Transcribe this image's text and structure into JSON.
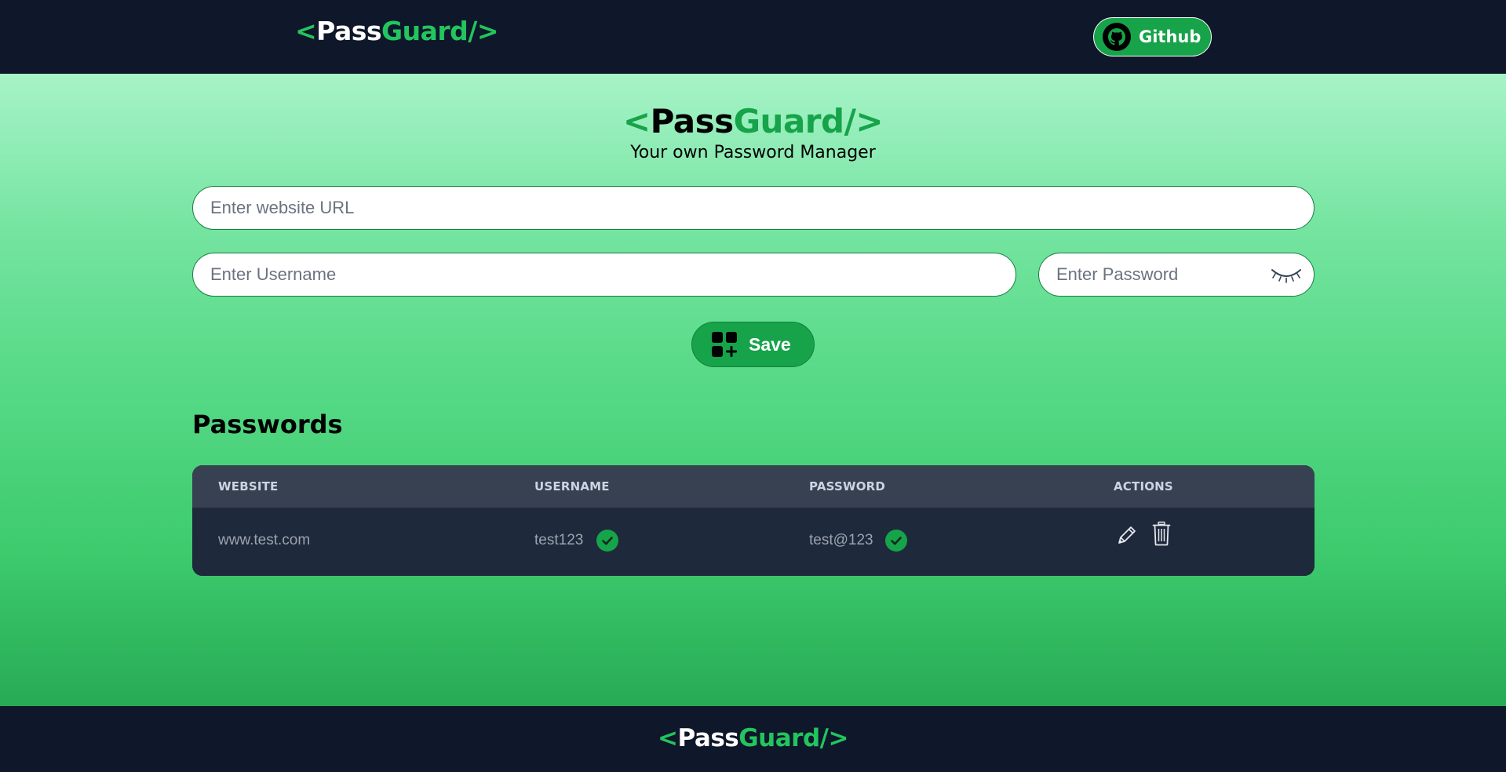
{
  "brand": {
    "open": "<",
    "pass": "Pass",
    "guard": "Guard",
    "close": "/>"
  },
  "navbar": {
    "github_label": "Github"
  },
  "hero": {
    "subtitle": "Your own Password Manager"
  },
  "form": {
    "url_placeholder": "Enter website URL",
    "username_placeholder": "Enter Username",
    "password_placeholder": "Enter Password",
    "save_label": "Save"
  },
  "passwords": {
    "title": "Passwords",
    "columns": [
      "WEBSITE",
      "USERNAME",
      "PASSWORD",
      "ACTIONS"
    ],
    "rows": [
      {
        "website": "www.test.com",
        "username": "test123",
        "password": "test@123"
      }
    ]
  },
  "colors": {
    "navy": "#0f172a",
    "accent_green": "#22c55e",
    "button_green": "#16a34a",
    "table_header": "#374151",
    "table_body": "#1e293b"
  },
  "icons": {
    "github": "github-icon",
    "eye": "eye-closed-icon",
    "save": "apps-add-icon",
    "copy": "check-circle-icon",
    "edit": "pencil-icon",
    "delete": "trash-icon"
  }
}
